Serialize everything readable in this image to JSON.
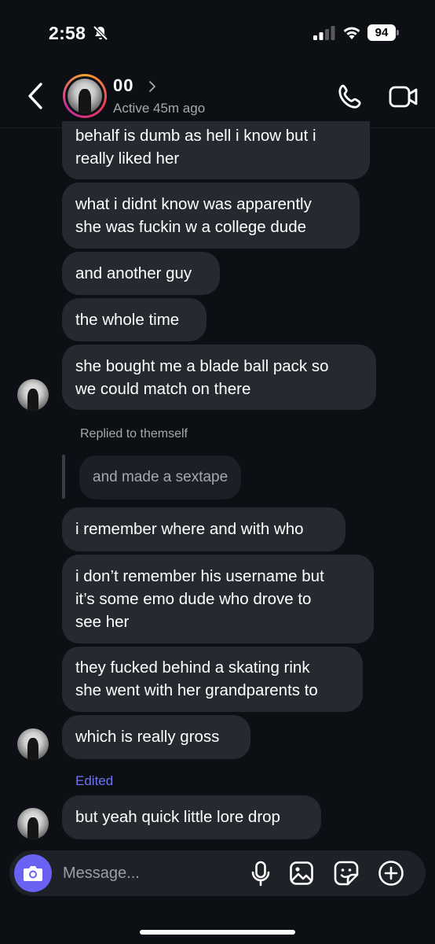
{
  "status_bar": {
    "time": "2:58",
    "battery_level": "94",
    "silent_mode": true
  },
  "header": {
    "contact_name": "00",
    "active_status": "Active 45m ago",
    "icons": [
      "back-chevron-icon",
      "call-icon",
      "video-call-icon"
    ]
  },
  "messages": [
    {
      "text": "behalf is dumb as hell i know but i\nreally liked her"
    },
    {
      "text": "what i didnt know was apparently\nshe was fuckin w a college dude"
    },
    {
      "text": "and another guy"
    },
    {
      "text": "the whole time"
    },
    {
      "text": "she bought me a blade ball pack so\nwe could match on there"
    },
    {
      "text": "i remember where and with who"
    },
    {
      "text": "i don’t remember his username but\nit’s some emo dude who drove to\nsee her"
    },
    {
      "text": "they fucked behind a skating rink\nshe went with her grandparents to"
    },
    {
      "text": "which is really gross"
    },
    {
      "text": "but yeah quick little lore drop"
    }
  ],
  "reply": {
    "label": "Replied to themself",
    "quoted_text": "and made a sextape"
  },
  "edited_label": "Edited",
  "composer": {
    "placeholder": "Message...",
    "icons": [
      "camera-icon",
      "microphone-icon",
      "gallery-icon",
      "sticker-icon",
      "plus-icon"
    ]
  },
  "colors": {
    "background": "#0c0f14",
    "bubble": "#262930",
    "accent": "#6962f3",
    "edited": "#6f74f2"
  }
}
